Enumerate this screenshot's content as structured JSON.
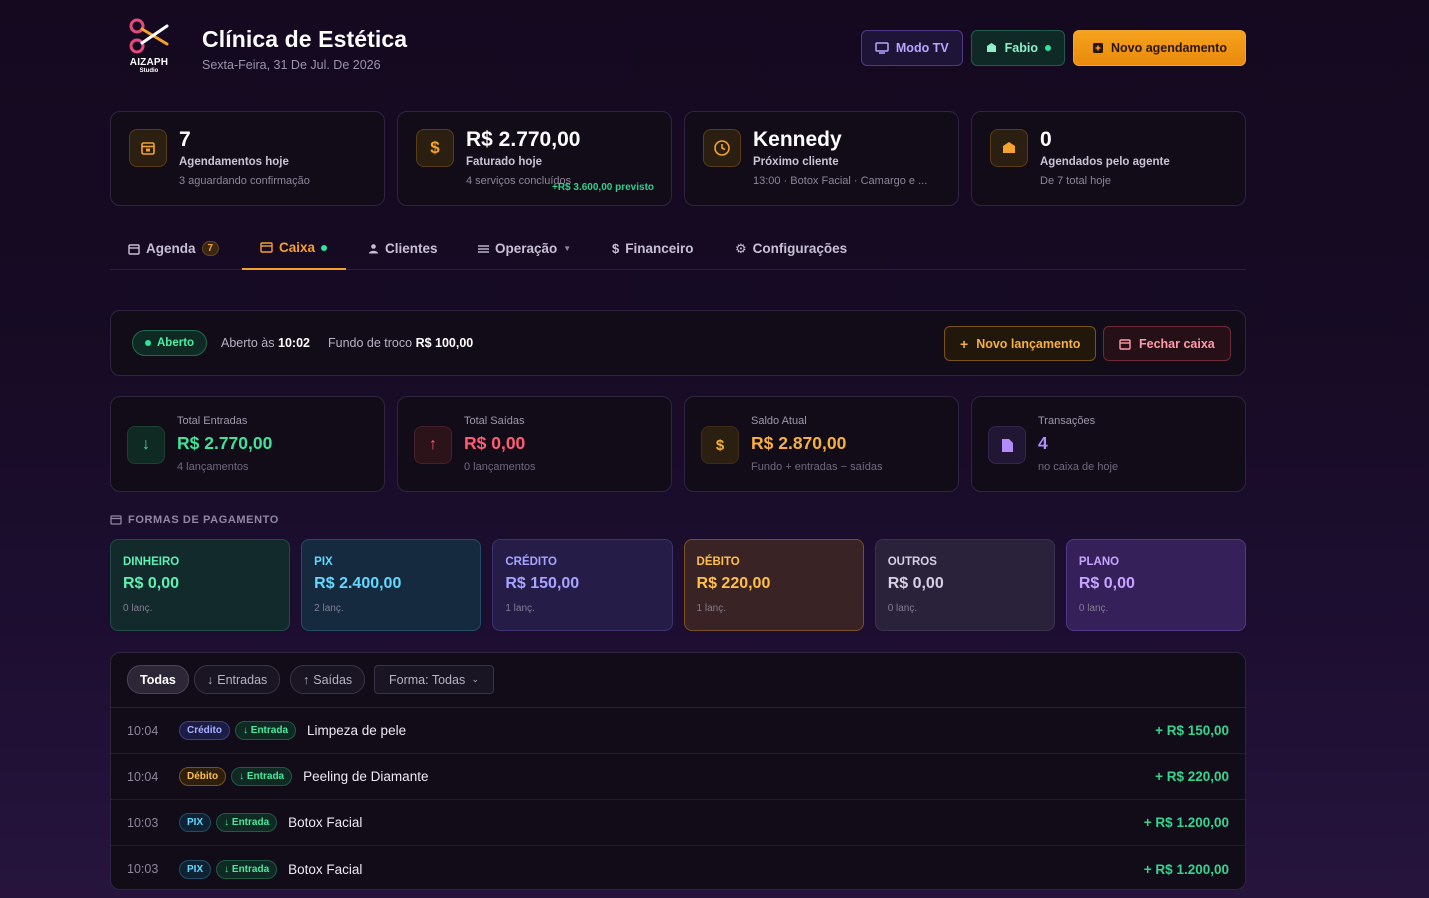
{
  "header": {
    "logo_name": "AIZAPH",
    "logo_sub": "Studio",
    "title": "Clínica de Estética",
    "date": "Sexta-Feira, 31 De Jul. De 2026",
    "btn_tv": "Modo TV",
    "btn_user": "Fabio",
    "btn_new": "Novo agendamento"
  },
  "stats": [
    {
      "value": "7",
      "label": "Agendamentos hoje",
      "sub": "3 aguardando confirmação",
      "icon": "calendar-icon"
    },
    {
      "value": "R$ 2.770,00",
      "label": "Faturado hoje",
      "sub": "4 serviços concluídos",
      "extra": "+R$ 3.600,00 previsto",
      "icon": "dollar-icon"
    },
    {
      "value": "Kennedy",
      "label": "Próximo cliente",
      "sub": "13:00 · Botox Facial · Camargo e ...",
      "icon": "clock-icon"
    },
    {
      "value": "0",
      "label": "Agendados pelo agente",
      "sub": "De 7 total hoje",
      "icon": "robot-icon"
    }
  ],
  "tabs": [
    {
      "label": "Agenda",
      "badge": "7"
    },
    {
      "label": "Caixa"
    },
    {
      "label": "Clientes"
    },
    {
      "label": "Operação"
    },
    {
      "label": "Financeiro"
    },
    {
      "label": "Configurações"
    }
  ],
  "caixa": {
    "status": "Aberto",
    "opened_prefix": "Aberto às",
    "opened_time": "10:02",
    "fund_prefix": "Fundo de troco",
    "fund_value": "R$ 100,00",
    "btn_lanc": "Novo lançamento",
    "btn_fechar": "Fechar caixa"
  },
  "totals": [
    {
      "label": "Total Entradas",
      "value": "R$ 2.770,00",
      "sub": "4 lançamentos",
      "color": "#3ee39a"
    },
    {
      "label": "Total Saídas",
      "value": "R$ 0,00",
      "sub": "0 lançamentos",
      "color": "#ff5b73"
    },
    {
      "label": "Saldo Atual",
      "value": "R$ 2.870,00",
      "sub": "Fundo + entradas − saídas",
      "color": "#f6b13a"
    },
    {
      "label": "Transações",
      "value": "4",
      "sub": "no caixa de hoje",
      "color": "#b28cff"
    }
  ],
  "payments": {
    "title": "FORMAS DE PAGAMENTO",
    "items": [
      {
        "name": "DINHEIRO",
        "value": "R$ 0,00",
        "count": "0 lanç."
      },
      {
        "name": "PIX",
        "value": "R$ 2.400,00",
        "count": "2 lanç."
      },
      {
        "name": "CRÉDITO",
        "value": "R$ 150,00",
        "count": "1 lanç."
      },
      {
        "name": "DÉBITO",
        "value": "R$ 220,00",
        "count": "1 lanç."
      },
      {
        "name": "OUTROS",
        "value": "R$ 0,00",
        "count": "0 lanç."
      },
      {
        "name": "PLANO",
        "value": "R$ 0,00",
        "count": "0 lanç."
      }
    ]
  },
  "filters": {
    "all": "Todas",
    "in": "Entradas",
    "out": "Saídas",
    "select": "Forma: Todas"
  },
  "transactions": [
    {
      "time": "10:04",
      "method": "Crédito",
      "type": "Entrada",
      "desc": "Limpeza de pele",
      "amount": "+ R$ 150,00"
    },
    {
      "time": "10:04",
      "method": "Débito",
      "type": "Entrada",
      "desc": "Peeling de Diamante",
      "amount": "+ R$ 220,00"
    },
    {
      "time": "10:03",
      "method": "PIX",
      "type": "Entrada",
      "desc": "Botox Facial",
      "amount": "+ R$ 1.200,00"
    },
    {
      "time": "10:03",
      "method": "PIX",
      "type": "Entrada",
      "desc": "Botox Facial",
      "amount": "+ R$ 1.200,00"
    }
  ]
}
